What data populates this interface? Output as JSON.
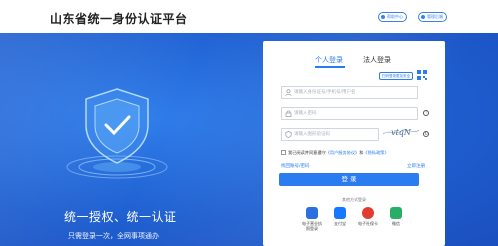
{
  "header": {
    "title": "山东省统一身份认证平台",
    "help_label": "帮助中心",
    "manage_label": "管理后端"
  },
  "banner": {
    "slogan": "统一授权、统一认证",
    "subslogan": "只需登录一次，全网事项通办"
  },
  "login": {
    "tabs": [
      {
        "label": "个人登录",
        "active": true
      },
      {
        "label": "法人登录",
        "active": false
      }
    ],
    "qr_badge": "扫码登录更加安全",
    "account_placeholder": "请输入身份证号/手机号/用户名",
    "password_placeholder": "请输入密码",
    "captcha_placeholder": "请输入图形验证码",
    "captcha_text": "vtqN",
    "agree_prefix": "我已阅读并同意遵守",
    "agree_link1": "《用户服务协议》",
    "agree_and": "和",
    "agree_link2": "《隐私政策》",
    "forgot_label": "找回账号/密码",
    "register_label": "立即注册",
    "login_button": "登 录",
    "other_title": "其他方式登录",
    "other_methods": [
      {
        "label": "电子营业执照登录",
        "line1": "电子营业执",
        "line2": "照登录",
        "color": "#2b6fe0",
        "icon": "license-icon"
      },
      {
        "label": "支付宝",
        "color": "#1677ff",
        "icon": "alipay-icon"
      },
      {
        "label": "电子社保卡",
        "color": "#e23b30",
        "icon": "social-security-card-icon"
      },
      {
        "label": "微信",
        "color": "#2aae67",
        "icon": "wechat-icon"
      }
    ]
  },
  "colors": {
    "accent": "#2b7cf0",
    "banner": "#1f5fd0"
  }
}
